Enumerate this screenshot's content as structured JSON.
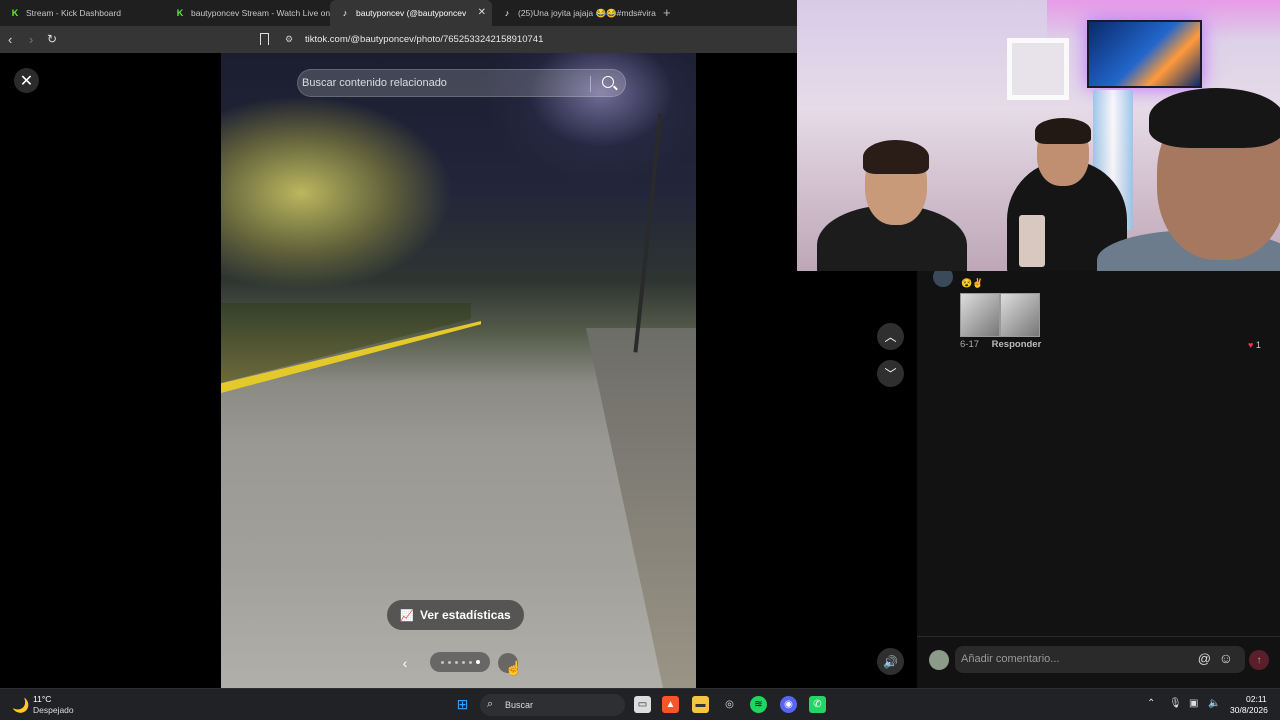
{
  "browser": {
    "tabs": [
      {
        "label": "Stream - Kick Dashboard",
        "favicon": "kick-icon"
      },
      {
        "label": "bautyponcev Stream - Watch Live on",
        "favicon": "kick-icon"
      },
      {
        "label": "bautyponcev (@bautyponcev",
        "favicon": "tiktok-icon",
        "active": true
      },
      {
        "label": "(25)Una joyita jajaja 😂😂#mds#vira",
        "favicon": "tiktok-icon"
      }
    ],
    "new_tab": "+",
    "url": "tiktok.com/@bautyponcev/photo/7652533242158910741"
  },
  "viewer": {
    "search_placeholder": "Buscar contenido relacionado",
    "stats_button": "Ver estadísticas",
    "carousel": {
      "total": 6,
      "active": 6
    }
  },
  "comment": {
    "emojis": "😵✌️",
    "date": "6-17",
    "reply": "Responder",
    "likes": "1"
  },
  "composer": {
    "placeholder": "Añadir comentario...",
    "at_symbol": "@"
  },
  "taskbar": {
    "weather_temp": "11°C",
    "weather_desc": "Despejado",
    "search_placeholder": "Buscar",
    "time": "02:11",
    "date": "30/8/2026"
  },
  "colors": {
    "kick_green": "#53fc18",
    "tiktok_red": "#fe2c55",
    "panel_bg": "#121212"
  }
}
